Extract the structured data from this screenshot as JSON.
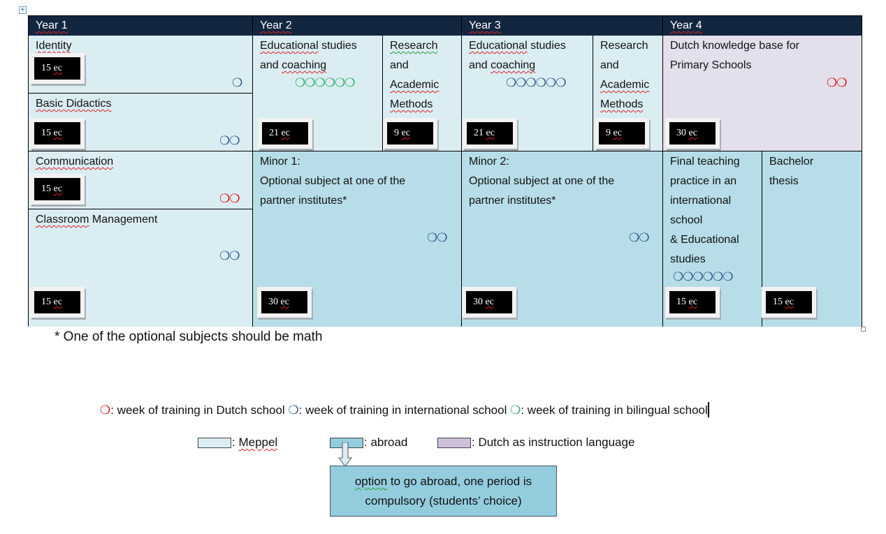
{
  "table": {
    "years": [
      "Year 1",
      "Year 2",
      "Year 3",
      "Year 4"
    ],
    "year1": {
      "identity": {
        "title": "Identity",
        "ec": "15",
        "ec_unit": "ec",
        "circles": "❍",
        "circle_color": "blue",
        "weeks": 1
      },
      "basic_didactics": {
        "title": "Basic Didactics",
        "ec": "15",
        "ec_unit": "ec",
        "circles": "❍❍",
        "circle_color": "blue",
        "weeks": 2
      },
      "communication": {
        "title": "Communication",
        "ec": "15",
        "ec_unit": "ec",
        "circles": "❍❍",
        "circle_color": "red",
        "weeks": 2
      },
      "classroom_management": {
        "title_a": "Classroom",
        "title_b": " Management",
        "ec": "15",
        "ec_unit": "ec",
        "circles": "❍❍",
        "circle_color": "blue",
        "weeks": 2
      }
    },
    "year2": {
      "edu_studies": {
        "line1a": "Educational",
        "line1b": " studies",
        "line2a": "and ",
        "line2b": "coaching",
        "ec": "21",
        "ec_unit": "ec",
        "circles": "❍❍❍❍❍❍",
        "circle_color": "green",
        "weeks": 6
      },
      "research": {
        "line1": "Research",
        "line2": "and",
        "line3": "Academic",
        "line4": "Methods",
        "ec": "9 ",
        "ec_unit": "ec"
      },
      "minor": {
        "line1": "Minor 1:",
        "line2": "Optional subject at one of the",
        "line3": "partner institutes*",
        "ec": "30",
        "ec_unit": "ec",
        "circles": "❍❍",
        "circle_color": "blue",
        "weeks": 2
      }
    },
    "year3": {
      "edu_studies": {
        "line1a": "Educational",
        "line1b": " studies",
        "line2a": "and ",
        "line2b": "coaching",
        "ec": "21",
        "ec_unit": "ec",
        "circles": "❍❍❍❍❍❍",
        "circle_color": "blue",
        "weeks": 6
      },
      "research": {
        "line1": "Research",
        "line2": "and",
        "line3": "Academic",
        "line4": "Methods",
        "ec": "9",
        "ec_unit": "ec"
      },
      "minor": {
        "line1": "Minor 2:",
        "line2": "Optional subject at one of the",
        "line3": "partner institutes*",
        "ec": "30",
        "ec_unit": "ec",
        "circles": "❍❍",
        "circle_color": "blue",
        "weeks": 2
      }
    },
    "year4": {
      "dutch_knowledge": {
        "line1": "Dutch knowledge base for",
        "line2": "Primary Schools",
        "ec": "30",
        "ec_unit": "ec",
        "circles": "❍❍",
        "circle_color": "red",
        "weeks": 2
      },
      "final_practice": {
        "line1": "Final teaching",
        "line2": "practice in an",
        "line3": "international",
        "line4": "school",
        "line5": "& Educational",
        "line6": "studies",
        "ec": "15",
        "ec_unit": "ec",
        "circles": "❍❍❍❍❍❍",
        "circle_color": "blue",
        "weeks": 6
      },
      "bachelor_thesis": {
        "line1": "Bachelor",
        "line2": "thesis",
        "ec": "15",
        "ec_unit": "ec"
      }
    }
  },
  "footnote": "* One of the optional subjects should be math",
  "legend": {
    "circle_glyph": "❍",
    "dutch_school": ": week of training in Dutch school ",
    "international_school": ": week of training in international school ",
    "bilingual_school": ": week of training in bilingual school",
    "meppel": ": Meppel",
    "abroad": ": abroad",
    "dutch_language": ": Dutch as instruction language"
  },
  "callout": {
    "line1a": "option",
    "line1b": " to go abroad, one period is",
    "line2": "compulsory (students’ choice)"
  },
  "colors": {
    "header": "#132640",
    "meppel": "#daedf3",
    "abroad": "#b7dde8",
    "dutch": "#e4dfec",
    "red_circle": "#e00000",
    "blue_circle": "#1f4e86",
    "green_circle": "#1fa855",
    "callout": "#93cddd"
  }
}
